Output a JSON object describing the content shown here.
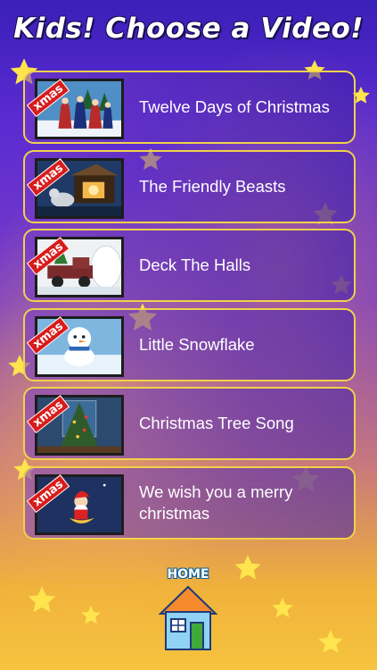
{
  "header": {
    "title": "Kids! Choose a Video!"
  },
  "badge_text": "xmas",
  "videos": [
    {
      "title": "Twelve Days of Christmas",
      "thumbnail": "carolers-thumbnail"
    },
    {
      "title": "The Friendly Beasts",
      "thumbnail": "nativity-thumbnail"
    },
    {
      "title": "Deck The Halls",
      "thumbnail": "truck-thumbnail"
    },
    {
      "title": "Little Snowflake",
      "thumbnail": "snowman-thumbnail"
    },
    {
      "title": "Christmas Tree Song",
      "thumbnail": "tree-thumbnail"
    },
    {
      "title": "We wish you a merry christmas",
      "thumbnail": "santa-thumbnail"
    }
  ],
  "home_button": {
    "label": "HOME",
    "icon": "house-icon"
  },
  "colors": {
    "row_border": "#f0d24a",
    "badge_red": "#d81b1b",
    "title_outline": "#1a0f55"
  }
}
